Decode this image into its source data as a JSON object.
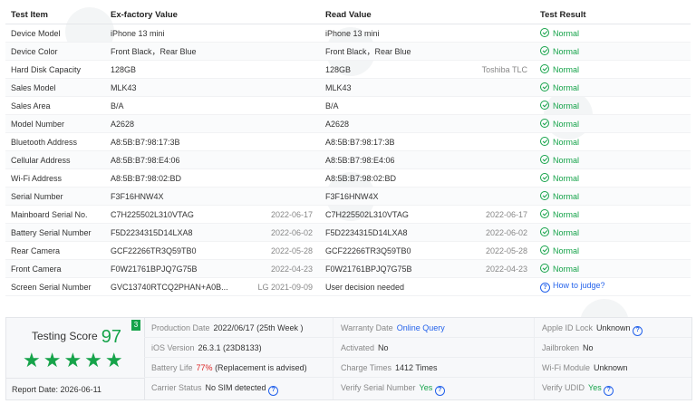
{
  "table": {
    "headers": {
      "item": "Test Item",
      "factory": "Ex-factory Value",
      "read": "Read Value",
      "result": "Test Result"
    },
    "rows": [
      {
        "item": "Device Model",
        "factory": "iPhone 13 mini",
        "factory_date": "",
        "read": "iPhone 13 mini",
        "read_date": "",
        "result": "Normal"
      },
      {
        "item": "Device Color",
        "factory": "Front Black，Rear Blue",
        "factory_date": "",
        "read": "Front Black，Rear Blue",
        "read_date": "",
        "result": "Normal"
      },
      {
        "item": "Hard Disk Capacity",
        "factory": "128GB",
        "factory_date": "",
        "read": "128GB",
        "read_date": "Toshiba TLC",
        "result": "Normal"
      },
      {
        "item": "Sales Model",
        "factory": "MLK43",
        "factory_date": "",
        "read": "MLK43",
        "read_date": "",
        "result": "Normal"
      },
      {
        "item": "Sales Area",
        "factory": "B/A",
        "factory_date": "",
        "read": "B/A",
        "read_date": "",
        "result": "Normal"
      },
      {
        "item": "Model Number",
        "factory": "A2628",
        "factory_date": "",
        "read": "A2628",
        "read_date": "",
        "result": "Normal"
      },
      {
        "item": "Bluetooth Address",
        "factory": "A8:5B:B7:98:17:3B",
        "factory_date": "",
        "read": "A8:5B:B7:98:17:3B",
        "read_date": "",
        "result": "Normal"
      },
      {
        "item": "Cellular Address",
        "factory": "A8:5B:B7:98:E4:06",
        "factory_date": "",
        "read": "A8:5B:B7:98:E4:06",
        "read_date": "",
        "result": "Normal"
      },
      {
        "item": "Wi-Fi Address",
        "factory": "A8:5B:B7:98:02:BD",
        "factory_date": "",
        "read": "A8:5B:B7:98:02:BD",
        "read_date": "",
        "result": "Normal"
      },
      {
        "item": "Serial Number",
        "factory": "F3F16HNW4X",
        "factory_date": "",
        "read": "F3F16HNW4X",
        "read_date": "",
        "result": "Normal"
      },
      {
        "item": "Mainboard Serial No.",
        "factory": "C7H225502L310VTAG",
        "factory_date": "2022-06-17",
        "read": "C7H225502L310VTAG",
        "read_date": "2022-06-17",
        "result": "Normal"
      },
      {
        "item": "Battery Serial Number",
        "factory": "F5D2234315D14LXA8",
        "factory_date": "2022-06-02",
        "read": "F5D2234315D14LXA8",
        "read_date": "2022-06-02",
        "result": "Normal"
      },
      {
        "item": "Rear Camera",
        "factory": "GCF22266TR3Q59TB0",
        "factory_date": "2022-05-28",
        "read": "GCF22266TR3Q59TB0",
        "read_date": "2022-05-28",
        "result": "Normal"
      },
      {
        "item": "Front Camera",
        "factory": "F0W21761BPJQ7G75B",
        "factory_date": "2022-04-23",
        "read": "F0W21761BPJQ7G75B",
        "read_date": "2022-04-23",
        "result": "Normal"
      },
      {
        "item": "Screen Serial Number",
        "factory": "GVC13740RTCQ2PHAN+A0B...",
        "factory_date": "LG 2021-09-09",
        "read": "User decision needed",
        "read_date": "",
        "result": "How to judge?",
        "result_type": "link"
      }
    ],
    "result_icon": "check-circle-icon",
    "link_icon": "question-circle-icon"
  },
  "summary": {
    "score_label": "Testing Score",
    "score": "97",
    "badge": "3",
    "stars": "★★★★★",
    "star_icon": "star-icon",
    "report_date_label": "Report Date:",
    "report_date": "2026-06-11",
    "fields": {
      "production_date": {
        "label": "Production Date",
        "value": "2022/06/17 (25th Week )"
      },
      "ios_version": {
        "label": "iOS Version",
        "value": "26.3.1 (23D8133)"
      },
      "battery_life": {
        "label": "Battery Life",
        "value_pct": "77%",
        "value_note": "(Replacement is advised)"
      },
      "carrier_status": {
        "label": "Carrier Status",
        "value": "No SIM detected"
      },
      "warranty_date": {
        "label": "Warranty Date",
        "value": "Online Query"
      },
      "activated": {
        "label": "Activated",
        "value": "No"
      },
      "charge_times": {
        "label": "Charge Times",
        "value": "1412 Times"
      },
      "verify_serial": {
        "label": "Verify Serial Number",
        "value": "Yes"
      },
      "apple_id_lock": {
        "label": "Apple ID Lock",
        "value": "Unknown"
      },
      "jailbroken": {
        "label": "Jailbroken",
        "value": "No"
      },
      "wifi_module": {
        "label": "Wi-Fi Module",
        "value": "Unknown"
      },
      "verify_udid": {
        "label": "Verify UDID",
        "value": "Yes"
      }
    }
  },
  "colors": {
    "green": "#16a34a",
    "link": "#2563eb",
    "warning": "#dc2626"
  }
}
